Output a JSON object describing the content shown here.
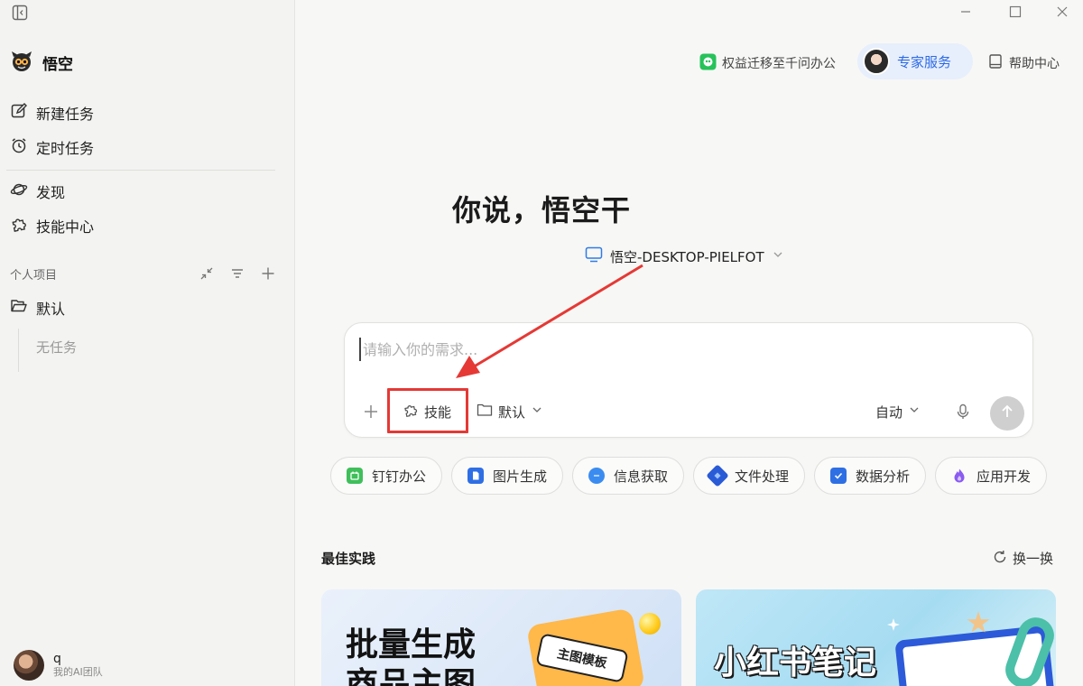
{
  "app": {
    "name": "悟空"
  },
  "sidebar": {
    "nav": [
      {
        "label": "新建任务",
        "icon": "edit-icon"
      },
      {
        "label": "定时任务",
        "icon": "alarm-clock-icon"
      },
      {
        "label": "发现",
        "icon": "planet-icon"
      },
      {
        "label": "技能中心",
        "icon": "puzzle-icon"
      }
    ],
    "section_title": "个人项目",
    "project": {
      "label": "默认",
      "icon": "folder-open-icon"
    },
    "empty_text": "无任务",
    "user": {
      "name": "q",
      "team": "我的AI团队"
    }
  },
  "header": {
    "migrate_label": "权益迁移至千问办公",
    "expert_label": "专家服务",
    "help_label": "帮助中心"
  },
  "hero": {
    "title": "你说，悟空干",
    "device": "悟空-DESKTOP-PIELFOT"
  },
  "composer": {
    "placeholder": "请输入你的需求...",
    "skill_label": "技能",
    "folder_label": "默认",
    "mode_label": "自动"
  },
  "chips": [
    {
      "label": "钉钉办公",
      "icon": "dingtalk-icon",
      "color": "#3fbf5a"
    },
    {
      "label": "图片生成",
      "icon": "image-doc-icon",
      "color": "#2f6fe4"
    },
    {
      "label": "信息获取",
      "icon": "chat-bubble-icon",
      "color": "#3b8cf0"
    },
    {
      "label": "文件处理",
      "icon": "cube-icon",
      "color": "#2a5bd7"
    },
    {
      "label": "数据分析",
      "icon": "checkbox-icon",
      "color": "#2f6fe4"
    },
    {
      "label": "应用开发",
      "icon": "flame-icon",
      "color": "#8a5cf0"
    }
  ],
  "best_practice": {
    "title": "最佳实践",
    "refresh_label": "换一换",
    "cards": [
      {
        "title_line1": "批量生成",
        "title_line2": "商品主图",
        "tag": "主图模板"
      },
      {
        "title": "小红书笔记"
      }
    ]
  },
  "colors": {
    "accent": "#2b6ae6",
    "annotation": "#e53935"
  }
}
